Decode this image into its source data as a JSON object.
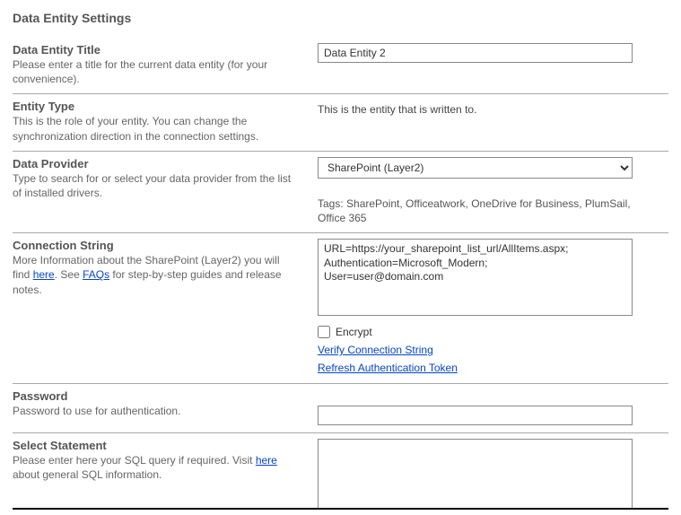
{
  "page_title": "Data Entity Settings",
  "sections": {
    "title": {
      "label": "Data Entity Title",
      "desc": "Please enter a title for the current data entity (for your convenience).",
      "value": "Data Entity 2"
    },
    "entity_type": {
      "label": "Entity Type",
      "desc": "This is the role of your entity. You can change the synchronization direction in the connection settings.",
      "static": "This is the entity that is written to."
    },
    "data_provider": {
      "label": "Data Provider",
      "desc": "Type to search for or select your data provider from the list of installed drivers.",
      "selected": "SharePoint (Layer2)",
      "tags": "Tags: SharePoint, Officeatwork, OneDrive for Business, PlumSail, Office 365"
    },
    "conn_string": {
      "label": "Connection String",
      "desc_prefix": "More Information about the SharePoint (Layer2) you will find ",
      "here1": "here",
      "desc_mid": ". See ",
      "faqs": "FAQs",
      "desc_suffix": " for step-by-step guides and release notes.",
      "value": "URL=https://your_sharepoint_list_url/AllItems.aspx;\nAuthentication=Microsoft_Modern;\nUser=user@domain.com",
      "encrypt_label": "Encrypt",
      "verify_link": "Verify Connection String",
      "refresh_link": "Refresh Authentication Token"
    },
    "password": {
      "label": "Password",
      "desc": "Password to use for authentication.",
      "value": ""
    },
    "select_stmt": {
      "label": "Select Statement",
      "desc_prefix": "Please enter here your SQL query if required. Visit ",
      "here": "here",
      "desc_suffix": " about general SQL information.",
      "value": ""
    }
  }
}
